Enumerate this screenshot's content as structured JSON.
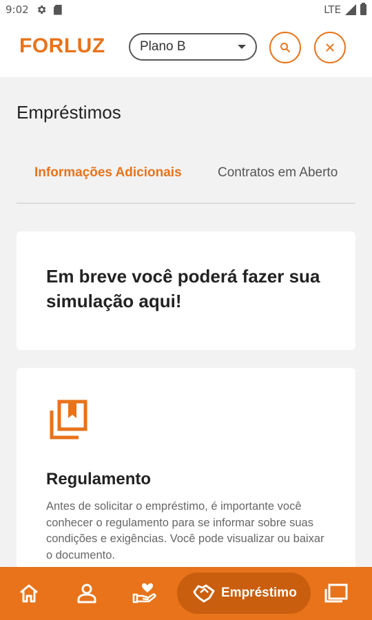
{
  "status_bar": {
    "time": "9:02",
    "network": "LTE"
  },
  "header": {
    "logo": "FORLUZ",
    "plan_select": {
      "value": "Plano B"
    },
    "accent_color": "#e8731a"
  },
  "page": {
    "title": "Empréstimos",
    "tabs": [
      {
        "label": "Informações Adicionais",
        "active": true
      },
      {
        "label": "Contratos em Aberto",
        "active": false
      }
    ]
  },
  "simulation_card": {
    "text": "Em breve você poderá fazer sua simulação aqui!"
  },
  "regulation_card": {
    "icon": "bookmark-book-icon",
    "title": "Regulamento",
    "description": "Antes de solicitar o empréstimo, é importante você conhecer o regulamento para se informar sobre suas condições e exigências. Você pode visualizar ou baixar o documento."
  },
  "bottom_nav": {
    "items": [
      {
        "icon": "home-icon"
      },
      {
        "icon": "user-icon"
      },
      {
        "icon": "hand-heart-icon"
      },
      {
        "icon": "handshake-icon",
        "label": "Empréstimo",
        "active": true
      },
      {
        "icon": "copy-cards-icon"
      }
    ]
  }
}
